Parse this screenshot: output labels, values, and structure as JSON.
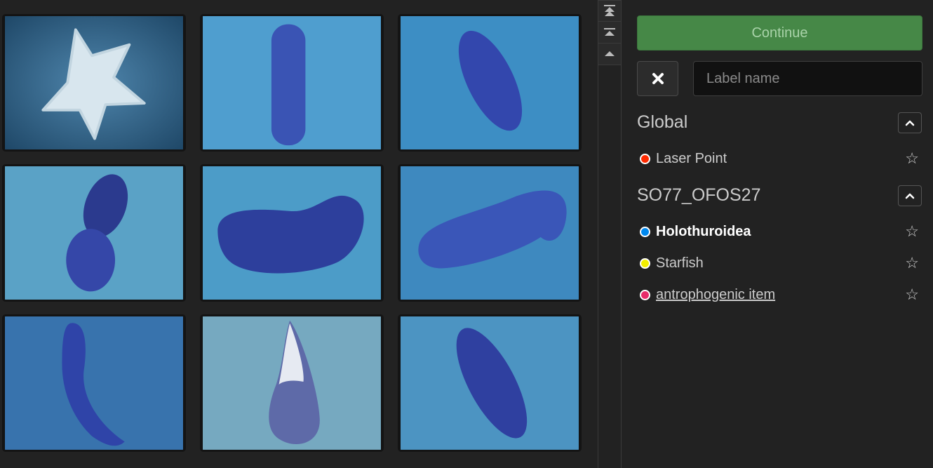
{
  "images": [
    {
      "subject": "starfish"
    },
    {
      "subject": "holothuroidea"
    },
    {
      "subject": "holothuroidea"
    },
    {
      "subject": "holothuroidea"
    },
    {
      "subject": "holothuroidea"
    },
    {
      "subject": "holothuroidea"
    },
    {
      "subject": "holothuroidea"
    },
    {
      "subject": "holothuroidea"
    },
    {
      "subject": "holothuroidea"
    }
  ],
  "scroll_buttons": [
    {
      "icon": "scroll-to-top-icon"
    },
    {
      "icon": "page-up-icon"
    },
    {
      "icon": "scroll-up-icon"
    }
  ],
  "sidebar": {
    "continue_label": "Continue",
    "clear_icon": "close-icon",
    "label_input_placeholder": "Label name",
    "groups": [
      {
        "title": "Global",
        "labels": [
          {
            "name": "Laser Point",
            "color": "#ff2a00",
            "style": "normal"
          }
        ]
      },
      {
        "title": "SO77_OFOS27",
        "labels": [
          {
            "name": "Holothuroidea",
            "color": "#0088ee",
            "style": "bold"
          },
          {
            "name": "Starfish",
            "color": "#f2ee00",
            "style": "normal"
          },
          {
            "name": "antrophogenic item",
            "color": "#e82c6a",
            "style": "underline"
          }
        ]
      }
    ]
  },
  "colors": {
    "continue_bg": "#468847",
    "background": "#222222",
    "input_bg": "#111111"
  }
}
